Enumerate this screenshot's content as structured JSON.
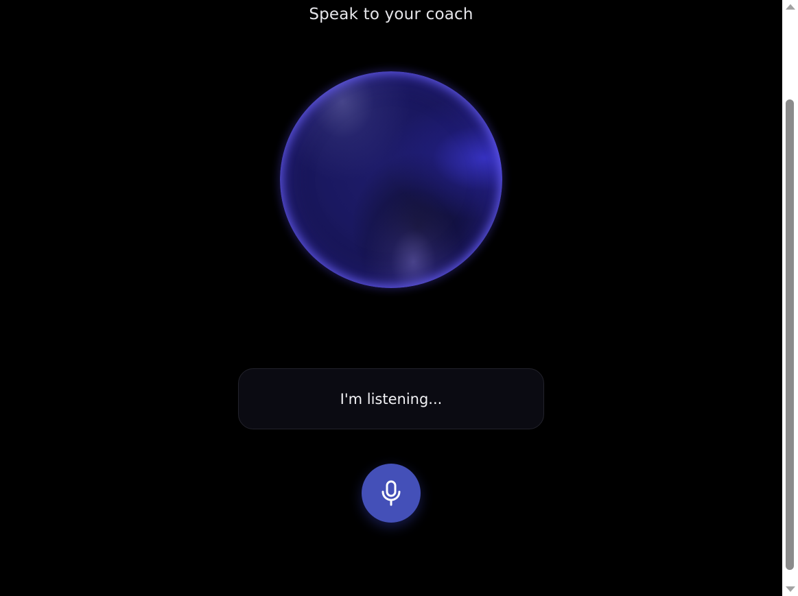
{
  "header": {
    "title": "Speak to your coach"
  },
  "orb": {
    "icon": "voice-orb",
    "accent_color": "#3a36c8"
  },
  "status": {
    "text": "I'm listening..."
  },
  "mic_button": {
    "icon": "microphone-icon",
    "color": "#4450b8"
  },
  "colors": {
    "background": "#000000",
    "status_box_bg": "#0b0b12",
    "text": "#f2f2f5"
  }
}
